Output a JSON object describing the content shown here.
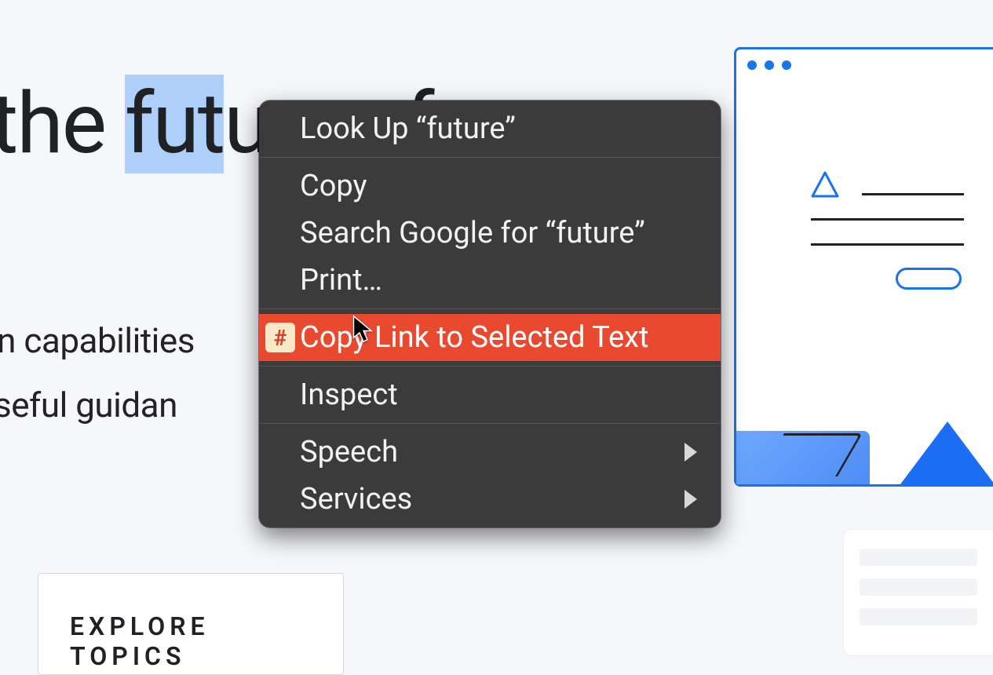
{
  "heading": {
    "prefix": "ld the ",
    "highlighted": "fut",
    "suffix": "ure of"
  },
  "subtext": {
    "line1": "odern capabilities",
    "line2": "ith useful guidan"
  },
  "explore": {
    "label": "EXPLORE TOPICS"
  },
  "context_menu": {
    "items": [
      {
        "label": "Look Up “future”",
        "type": "item"
      },
      {
        "type": "separator"
      },
      {
        "label": "Copy",
        "type": "item"
      },
      {
        "label": "Search Google for “future”",
        "type": "item"
      },
      {
        "label": "Print…",
        "type": "item"
      },
      {
        "type": "separator"
      },
      {
        "label": "Copy Link to Selected Text",
        "type": "item",
        "highlighted": true,
        "icon": "hash"
      },
      {
        "type": "separator"
      },
      {
        "label": "Inspect",
        "type": "item"
      },
      {
        "type": "separator"
      },
      {
        "label": "Speech",
        "type": "submenu"
      },
      {
        "label": "Services",
        "type": "submenu"
      }
    ]
  },
  "illustration": {
    "window_dots": 3
  }
}
